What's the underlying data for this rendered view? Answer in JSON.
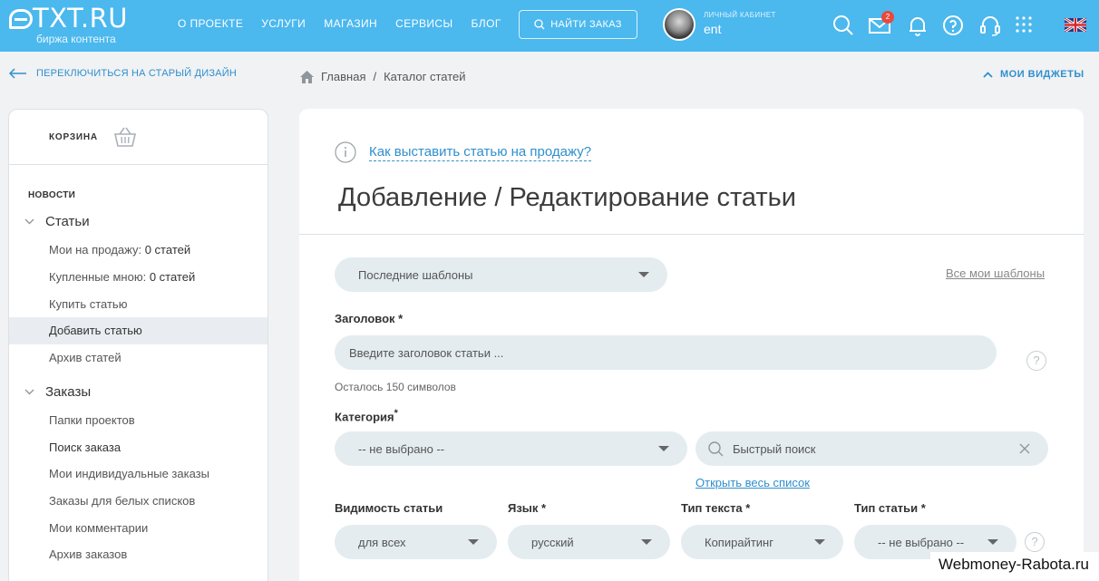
{
  "header": {
    "logo_text": "TXT.RU",
    "logo_subtitle": "биржа контента",
    "nav": [
      "О ПРОЕКТЕ",
      "УСЛУГИ",
      "МАГАЗИН",
      "СЕРВИСЫ",
      "БЛОГ"
    ],
    "find_order": "НАЙТИ ЗАКАЗ",
    "cabinet_label": "ЛИЧНЫЙ КАБИНЕТ",
    "username": "ent",
    "mail_badge": "2",
    "icons": [
      "search-icon",
      "mail-icon",
      "bell-icon",
      "help-icon",
      "headset-icon",
      "apps-grid-icon",
      "uk-flag-icon"
    ]
  },
  "subheader": {
    "switch_design": "ПЕРЕКЛЮЧИТЬСЯ НА СТАРЫЙ ДИЗАЙН",
    "breadcrumb": [
      "Главная",
      "Каталог статей"
    ],
    "breadcrumb_sep": "/",
    "widgets": "МОИ ВИДЖЕТЫ"
  },
  "sidebar": {
    "cart": "КОРЗИНА",
    "news": "НОВОСТИ",
    "articles_title": "Статьи",
    "articles": {
      "for_sale_label": "Мои на продажу:",
      "for_sale_count": "0 статей",
      "bought_label": "Купленные мною:",
      "bought_count": "0 статей",
      "buy": "Купить статью",
      "add": "Добавить статью",
      "archive": "Архив статей"
    },
    "orders_title": "Заказы",
    "orders": [
      "Папки проектов",
      "Поиск заказа",
      "Мои индивидуальные заказы",
      "Заказы для белых списков",
      "Мои комментарии",
      "Архив заказов"
    ]
  },
  "main": {
    "howto_link": "Как выставить статью на продажу?",
    "title": "Добавление / Редактирование статьи",
    "templates_select": "Последние шаблоны",
    "all_templates": "Все мои шаблоны",
    "title_label": "Заголовок *",
    "title_placeholder": "Введите заголовок статьи ...",
    "chars_left": "Осталось 150 символов",
    "category_label": "Категория",
    "required_mark": "*",
    "category_select": "-- не выбрано --",
    "quick_search_placeholder": "Быстрый поиск",
    "open_full_list": "Открыть весь список",
    "visibility_label": "Видимость статьи",
    "visibility_value": "для всех",
    "language_label": "Язык *",
    "language_value": "русский",
    "text_type_label": "Тип текста *",
    "text_type_value": "Копирайтинг",
    "article_type_label": "Тип статьи *",
    "article_type_value": "-- не выбрано --",
    "help_mark": "?"
  },
  "watermark": "Webmoney-Rabota.ru"
}
